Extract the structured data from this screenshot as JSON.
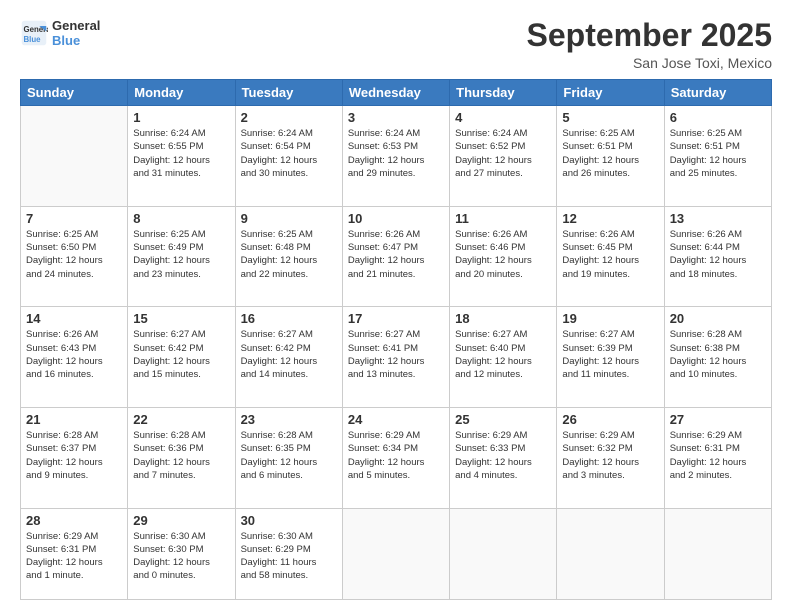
{
  "header": {
    "logo_line1": "General",
    "logo_line2": "Blue",
    "month": "September 2025",
    "location": "San Jose Toxi, Mexico"
  },
  "weekdays": [
    "Sunday",
    "Monday",
    "Tuesday",
    "Wednesday",
    "Thursday",
    "Friday",
    "Saturday"
  ],
  "weeks": [
    [
      {
        "num": "",
        "info": ""
      },
      {
        "num": "1",
        "info": "Sunrise: 6:24 AM\nSunset: 6:55 PM\nDaylight: 12 hours\nand 31 minutes."
      },
      {
        "num": "2",
        "info": "Sunrise: 6:24 AM\nSunset: 6:54 PM\nDaylight: 12 hours\nand 30 minutes."
      },
      {
        "num": "3",
        "info": "Sunrise: 6:24 AM\nSunset: 6:53 PM\nDaylight: 12 hours\nand 29 minutes."
      },
      {
        "num": "4",
        "info": "Sunrise: 6:24 AM\nSunset: 6:52 PM\nDaylight: 12 hours\nand 27 minutes."
      },
      {
        "num": "5",
        "info": "Sunrise: 6:25 AM\nSunset: 6:51 PM\nDaylight: 12 hours\nand 26 minutes."
      },
      {
        "num": "6",
        "info": "Sunrise: 6:25 AM\nSunset: 6:51 PM\nDaylight: 12 hours\nand 25 minutes."
      }
    ],
    [
      {
        "num": "7",
        "info": "Sunrise: 6:25 AM\nSunset: 6:50 PM\nDaylight: 12 hours\nand 24 minutes."
      },
      {
        "num": "8",
        "info": "Sunrise: 6:25 AM\nSunset: 6:49 PM\nDaylight: 12 hours\nand 23 minutes."
      },
      {
        "num": "9",
        "info": "Sunrise: 6:25 AM\nSunset: 6:48 PM\nDaylight: 12 hours\nand 22 minutes."
      },
      {
        "num": "10",
        "info": "Sunrise: 6:26 AM\nSunset: 6:47 PM\nDaylight: 12 hours\nand 21 minutes."
      },
      {
        "num": "11",
        "info": "Sunrise: 6:26 AM\nSunset: 6:46 PM\nDaylight: 12 hours\nand 20 minutes."
      },
      {
        "num": "12",
        "info": "Sunrise: 6:26 AM\nSunset: 6:45 PM\nDaylight: 12 hours\nand 19 minutes."
      },
      {
        "num": "13",
        "info": "Sunrise: 6:26 AM\nSunset: 6:44 PM\nDaylight: 12 hours\nand 18 minutes."
      }
    ],
    [
      {
        "num": "14",
        "info": "Sunrise: 6:26 AM\nSunset: 6:43 PM\nDaylight: 12 hours\nand 16 minutes."
      },
      {
        "num": "15",
        "info": "Sunrise: 6:27 AM\nSunset: 6:42 PM\nDaylight: 12 hours\nand 15 minutes."
      },
      {
        "num": "16",
        "info": "Sunrise: 6:27 AM\nSunset: 6:42 PM\nDaylight: 12 hours\nand 14 minutes."
      },
      {
        "num": "17",
        "info": "Sunrise: 6:27 AM\nSunset: 6:41 PM\nDaylight: 12 hours\nand 13 minutes."
      },
      {
        "num": "18",
        "info": "Sunrise: 6:27 AM\nSunset: 6:40 PM\nDaylight: 12 hours\nand 12 minutes."
      },
      {
        "num": "19",
        "info": "Sunrise: 6:27 AM\nSunset: 6:39 PM\nDaylight: 12 hours\nand 11 minutes."
      },
      {
        "num": "20",
        "info": "Sunrise: 6:28 AM\nSunset: 6:38 PM\nDaylight: 12 hours\nand 10 minutes."
      }
    ],
    [
      {
        "num": "21",
        "info": "Sunrise: 6:28 AM\nSunset: 6:37 PM\nDaylight: 12 hours\nand 9 minutes."
      },
      {
        "num": "22",
        "info": "Sunrise: 6:28 AM\nSunset: 6:36 PM\nDaylight: 12 hours\nand 7 minutes."
      },
      {
        "num": "23",
        "info": "Sunrise: 6:28 AM\nSunset: 6:35 PM\nDaylight: 12 hours\nand 6 minutes."
      },
      {
        "num": "24",
        "info": "Sunrise: 6:29 AM\nSunset: 6:34 PM\nDaylight: 12 hours\nand 5 minutes."
      },
      {
        "num": "25",
        "info": "Sunrise: 6:29 AM\nSunset: 6:33 PM\nDaylight: 12 hours\nand 4 minutes."
      },
      {
        "num": "26",
        "info": "Sunrise: 6:29 AM\nSunset: 6:32 PM\nDaylight: 12 hours\nand 3 minutes."
      },
      {
        "num": "27",
        "info": "Sunrise: 6:29 AM\nSunset: 6:31 PM\nDaylight: 12 hours\nand 2 minutes."
      }
    ],
    [
      {
        "num": "28",
        "info": "Sunrise: 6:29 AM\nSunset: 6:31 PM\nDaylight: 12 hours\nand 1 minute."
      },
      {
        "num": "29",
        "info": "Sunrise: 6:30 AM\nSunset: 6:30 PM\nDaylight: 12 hours\nand 0 minutes."
      },
      {
        "num": "30",
        "info": "Sunrise: 6:30 AM\nSunset: 6:29 PM\nDaylight: 11 hours\nand 58 minutes."
      },
      {
        "num": "",
        "info": ""
      },
      {
        "num": "",
        "info": ""
      },
      {
        "num": "",
        "info": ""
      },
      {
        "num": "",
        "info": ""
      }
    ]
  ]
}
